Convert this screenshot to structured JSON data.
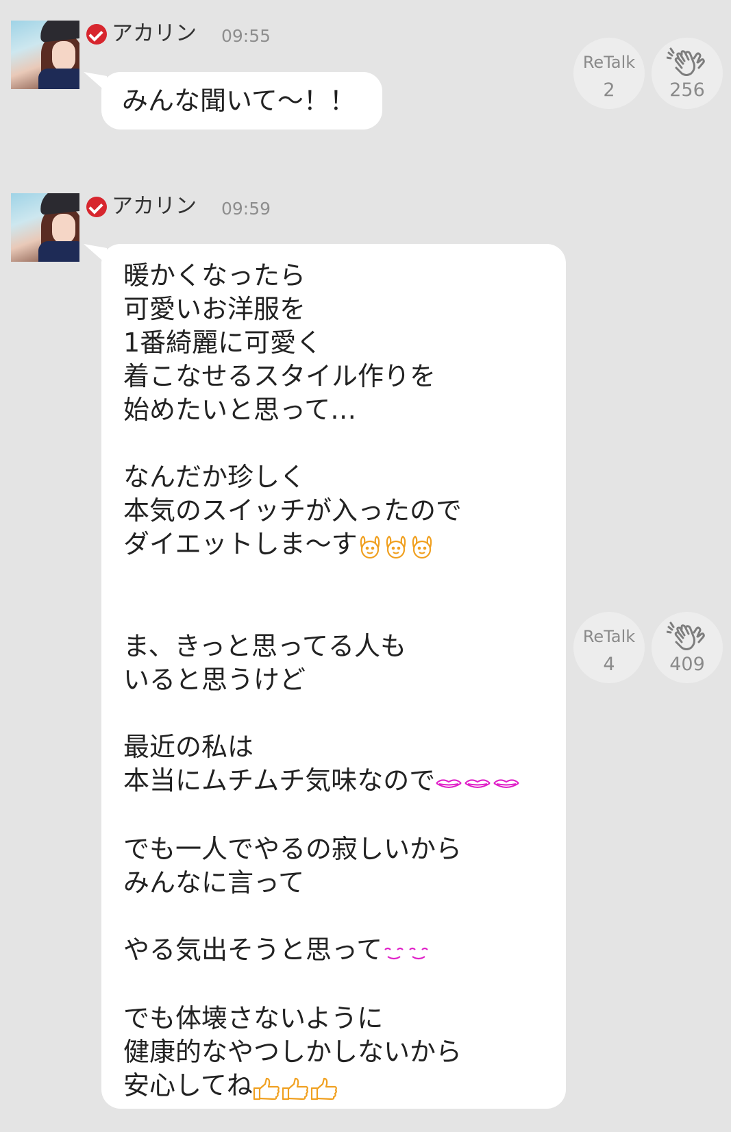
{
  "messages": [
    {
      "user": "アカリン",
      "time": "09:55",
      "text": "みんな聞いて〜！！",
      "retalk_label": "ReTalk",
      "retalk_count": "2",
      "clap_count": "256"
    },
    {
      "user": "アカリン",
      "time": "09:59",
      "lines": [
        "暖かくなったら",
        "可愛いお洋服を",
        "1番綺麗に可愛く",
        "着こなせるスタイル作りを",
        "始めたいと思って…",
        "",
        "なんだか珍しく",
        "本気のスイッチが入ったので",
        "ダイエットしま〜す",
        "",
        "",
        "ま、きっと思ってる人も",
        "いると思うけど",
        "",
        "最近の私は",
        "本当にムチムチ気味なので",
        "",
        "でも一人でやるの寂しいから",
        "みんなに言って",
        "",
        "やる気出そうと思って",
        "",
        "でも体壊さないように",
        "健康的なやつしかしないから",
        "安心してね"
      ],
      "emojis": {
        "face_raise": "raising-hands-face-emoji",
        "lips": "lips-emoji",
        "smile_eyes": "smiling-eyes-emoji",
        "thumbs": "thumbs-up-emoji"
      },
      "retalk_label": "ReTalk",
      "retalk_count": "4",
      "clap_count": "409"
    }
  ],
  "colors": {
    "background": "#e4e4e4",
    "bubble": "#ffffff",
    "verified": "#d7262e",
    "button": "#ededed",
    "emoji_orange": "#f0a020",
    "emoji_magenta": "#e020c8"
  }
}
